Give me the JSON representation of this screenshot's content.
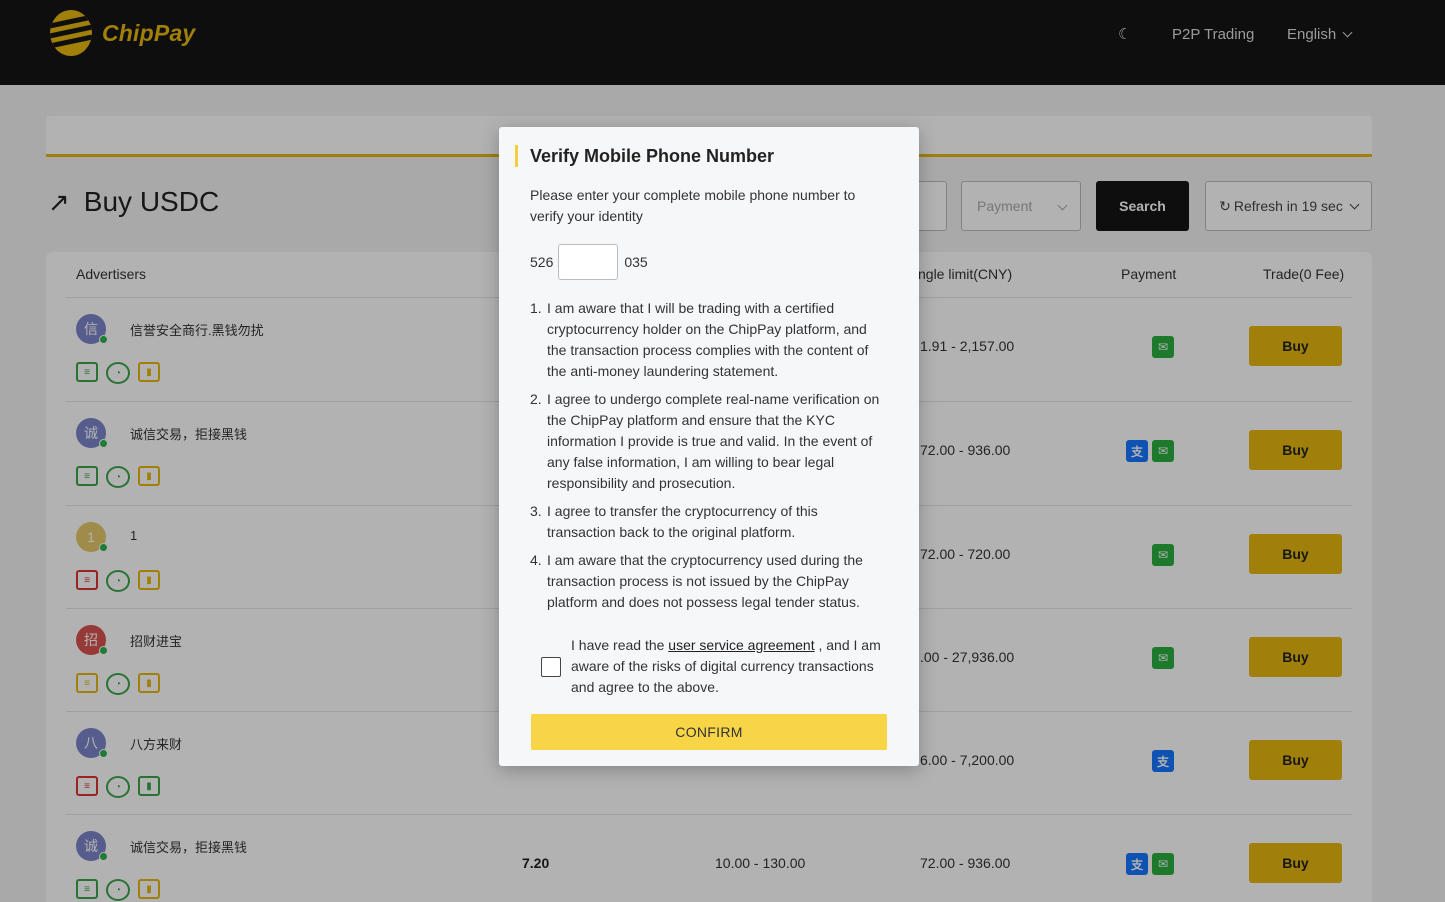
{
  "header": {
    "logo_text": "ChipPay",
    "theme_toggle": "☾",
    "nav_p2p": "P2P Trading",
    "language": "English"
  },
  "page": {
    "title": "Buy USDC",
    "title_icon": "↗",
    "payment_placeholder": "Payment",
    "search_label": "Search",
    "refresh_label": "Refresh in 19 sec",
    "refresh_icon": "↻"
  },
  "table": {
    "headers": {
      "advertisers": "Advertisers",
      "limit": "ngle limit(CNY)",
      "payment": "Payment",
      "trade": "Trade(0 Fee)"
    },
    "buy_label": "Buy",
    "rows": [
      {
        "avatar": "信",
        "name": "信誉安全商行.黑钱勿扰",
        "limit": "1.91 - 2,157.00",
        "price": "",
        "amount": "",
        "pay": [
          "wechat"
        ]
      },
      {
        "avatar": "诚",
        "name": "诚信交易，拒接黑钱",
        "limit": "72.00 - 936.00",
        "price": "",
        "amount": "",
        "pay": [
          "alipay",
          "wechat"
        ]
      },
      {
        "avatar": "1",
        "name": "1",
        "limit": "72.00 - 720.00",
        "price": "",
        "amount": "",
        "pay": [
          "wechat"
        ]
      },
      {
        "avatar": "招",
        "name": "招财进宝",
        "limit": ".00 - 27,936.00",
        "price": "",
        "amount": "",
        "pay": [
          "wechat"
        ]
      },
      {
        "avatar": "八",
        "name": "八方来财",
        "limit": "6.00 - 7,200.00",
        "price": "",
        "amount": "",
        "pay": [
          "alipay"
        ]
      },
      {
        "avatar": "诚",
        "name": "诚信交易，拒接黑钱",
        "limit": "72.00 - 936.00",
        "price": "7.20",
        "amount": "10.00 - 130.00",
        "pay": [
          "alipay",
          "wechat"
        ]
      }
    ],
    "pay_glyphs": {
      "wechat": "✉",
      "alipay": "支"
    },
    "badge_glyphs": {
      "doc": "≡",
      "clock": "◔",
      "chart": "▮"
    }
  },
  "modal": {
    "title": "Verify Mobile Phone Number",
    "description": "Please enter your complete mobile phone number to verify your identity",
    "phone_prefix": "526",
    "phone_suffix": "035",
    "phone_value": "",
    "terms": [
      {
        "num": "1.",
        "text": "I am aware that I will be trading with a certified cryptocurrency holder on the ChipPay platform, and the transaction process complies with the content of the anti-money laundering statement."
      },
      {
        "num": "2.",
        "text": "I agree to undergo complete real-name verification on the ChipPay platform and ensure that the KYC information I provide is true and valid. In the event of any false information, I am willing to bear legal responsibility and prosecution."
      },
      {
        "num": "3.",
        "text": "I agree to transfer the cryptocurrency of this transaction back to the original platform."
      },
      {
        "num": "4.",
        "text": "I am aware that the cryptocurrency used during the transaction process is not issued by the ChipPay platform and does not possess legal tender status."
      }
    ],
    "agree_prefix": "I have read the ",
    "agree_link": "user service agreement",
    "agree_suffix": " , and I am aware of the risks of digital currency transactions and agree to the above.",
    "confirm_label": "CONFIRM"
  },
  "colors": {
    "brand_yellow": "#e5b70f",
    "header_bg": "#151515",
    "confirm_bg": "#f7d547",
    "wechat": "#2aae3f",
    "alipay": "#1677ff"
  }
}
